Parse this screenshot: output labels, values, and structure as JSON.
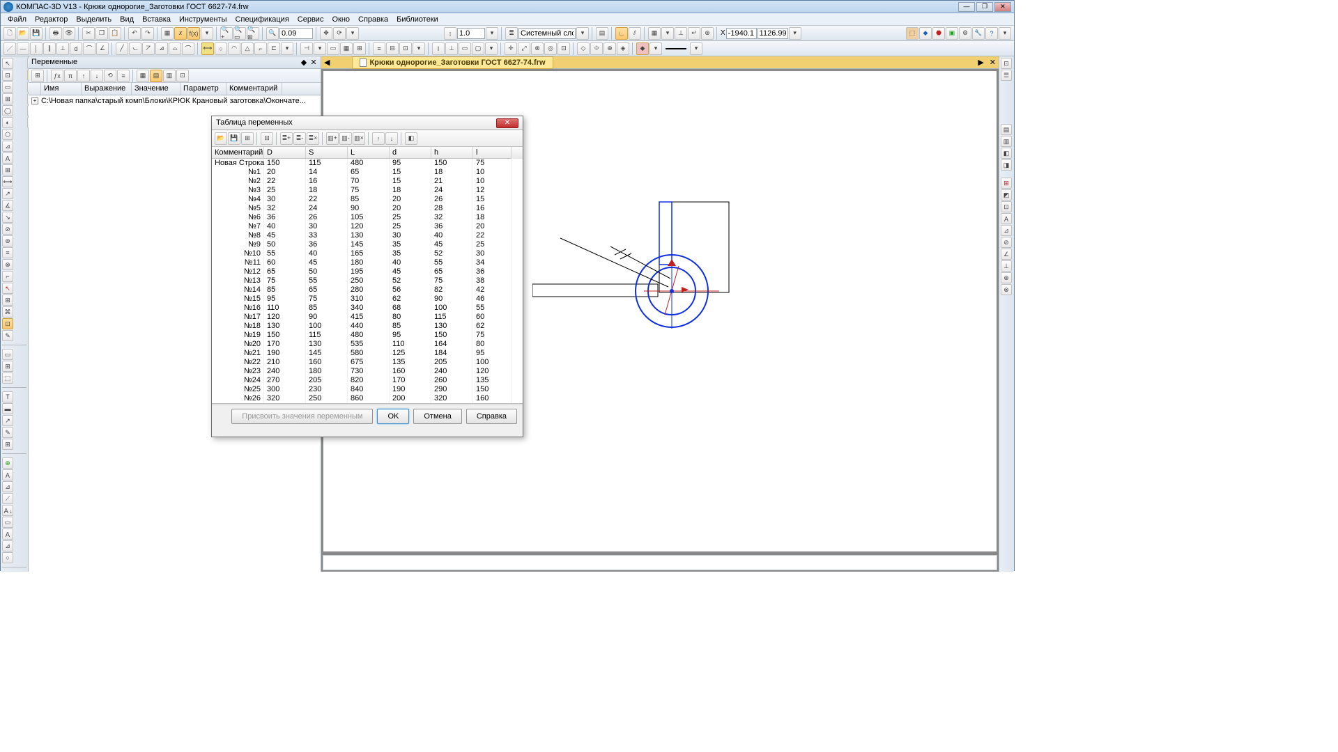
{
  "app": {
    "title": "КОМПАС-3D V13 - Крюки однорогие_Заготовки ГОСТ 6627-74.frw"
  },
  "menu": [
    "Файл",
    "Редактор",
    "Выделить",
    "Вид",
    "Вставка",
    "Инструменты",
    "Спецификация",
    "Сервис",
    "Окно",
    "Справка",
    "Библиотеки"
  ],
  "tb1_zoom": "0.09",
  "tb1_scale": "1.0",
  "tb1_layer": "Системный слой (",
  "coord_x": "-1940.1",
  "coord_y": "1126.99",
  "panel": {
    "title": "Переменные",
    "cols": [
      "Имя",
      "Выражение",
      "Значение",
      "Параметр",
      "Комментарий"
    ],
    "path": "C:\\Новая папка\\старый комп\\Блоки\\КРЮК Крановый заготовка\\Окончате..."
  },
  "doc_tab": "Крюки однорогие_Заготовки ГОСТ 6627-74.frw",
  "dialog": {
    "title": "Таблица переменных",
    "cols": [
      "Комментарий",
      "D",
      "S",
      "L",
      "d",
      "h",
      "l"
    ],
    "firstRowLabel": "Новая Строка",
    "rows": [
      [
        "150",
        "115",
        "480",
        "95",
        "150",
        "75"
      ],
      [
        "20",
        "14",
        "65",
        "15",
        "18",
        "10"
      ],
      [
        "22",
        "16",
        "70",
        "15",
        "21",
        "10"
      ],
      [
        "25",
        "18",
        "75",
        "18",
        "24",
        "12"
      ],
      [
        "30",
        "22",
        "85",
        "20",
        "26",
        "15"
      ],
      [
        "32",
        "24",
        "90",
        "20",
        "28",
        "16"
      ],
      [
        "36",
        "26",
        "105",
        "25",
        "32",
        "18"
      ],
      [
        "40",
        "30",
        "120",
        "25",
        "36",
        "20"
      ],
      [
        "45",
        "33",
        "130",
        "30",
        "40",
        "22"
      ],
      [
        "50",
        "36",
        "145",
        "35",
        "45",
        "25"
      ],
      [
        "55",
        "40",
        "165",
        "35",
        "52",
        "30"
      ],
      [
        "60",
        "45",
        "180",
        "40",
        "55",
        "34"
      ],
      [
        "65",
        "50",
        "195",
        "45",
        "65",
        "36"
      ],
      [
        "75",
        "55",
        "250",
        "52",
        "75",
        "38"
      ],
      [
        "85",
        "65",
        "280",
        "56",
        "82",
        "42"
      ],
      [
        "95",
        "75",
        "310",
        "62",
        "90",
        "46"
      ],
      [
        "110",
        "85",
        "340",
        "68",
        "100",
        "55"
      ],
      [
        "120",
        "90",
        "415",
        "80",
        "115",
        "60"
      ],
      [
        "130",
        "100",
        "440",
        "85",
        "130",
        "62"
      ],
      [
        "150",
        "115",
        "480",
        "95",
        "150",
        "75"
      ],
      [
        "170",
        "130",
        "535",
        "110",
        "164",
        "80"
      ],
      [
        "190",
        "145",
        "580",
        "125",
        "184",
        "95"
      ],
      [
        "210",
        "160",
        "675",
        "135",
        "205",
        "100"
      ],
      [
        "240",
        "180",
        "730",
        "160",
        "240",
        "120"
      ],
      [
        "270",
        "205",
        "820",
        "170",
        "260",
        "135"
      ],
      [
        "300",
        "230",
        "840",
        "190",
        "290",
        "150"
      ],
      [
        "320",
        "250",
        "860",
        "200",
        "320",
        "160"
      ]
    ],
    "btn_assign": "Присвоить значения переменным",
    "btn_ok": "OK",
    "btn_cancel": "Отмена",
    "btn_help": "Справка"
  }
}
